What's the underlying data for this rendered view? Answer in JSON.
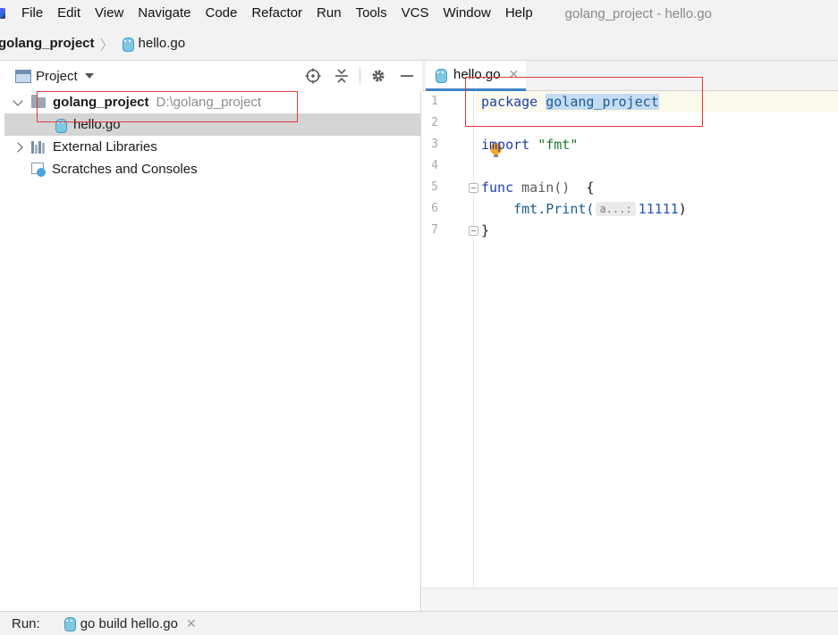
{
  "menu": {
    "items": [
      "File",
      "Edit",
      "View",
      "Navigate",
      "Code",
      "Refactor",
      "Run",
      "Tools",
      "VCS",
      "Window",
      "Help"
    ],
    "window_title": "golang_project - hello.go"
  },
  "breadcrumb": {
    "root": "golang_project",
    "file": "hello.go"
  },
  "project_panel": {
    "title": "Project",
    "tree": {
      "project_name": "golang_project",
      "project_path": "D:\\golang_project",
      "file": "hello.go",
      "external_libraries": "External Libraries",
      "scratches": "Scratches and Consoles"
    }
  },
  "editor": {
    "tab_label": "hello.go",
    "line_numbers": [
      "1",
      "2",
      "3",
      "4",
      "5",
      "6",
      "7"
    ],
    "code": {
      "line1_kw": "package",
      "line1_name": "golang_project",
      "line3_kw": "import",
      "line3_str": "\"fmt\"",
      "line5_kw": "func",
      "line5_name": "main()",
      "line5_brace": "{",
      "line6_call": "fmt.Print(",
      "line6_hint": "a...:",
      "line6_num": "11111",
      "line6_end": ")",
      "line7": "}"
    }
  },
  "runbar": {
    "label": "Run:",
    "tab_label": "go build hello.go"
  },
  "colors": {
    "annotation": "#e03a3a",
    "accent": "#4083c9",
    "bulb": "#f5a623"
  }
}
